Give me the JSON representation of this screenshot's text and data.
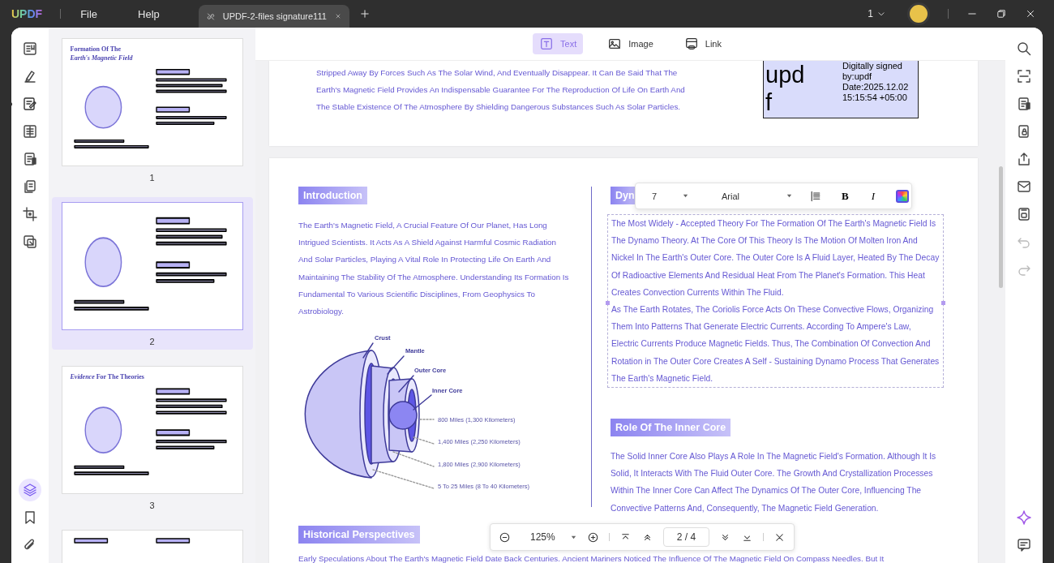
{
  "app": {
    "logo": "UPDF",
    "menu": [
      "File",
      "Help"
    ]
  },
  "tabs": [
    {
      "title": "UPDF-2-files signature111",
      "selected": true
    }
  ],
  "window": {
    "page_selector": "1"
  },
  "left_tools": [
    {
      "kind": "reader",
      "selected": false
    },
    {
      "kind": "comment",
      "selected": false
    },
    {
      "kind": "edit",
      "selected": true
    },
    {
      "kind": "form",
      "selected": false
    },
    {
      "kind": "convert",
      "selected": false
    },
    {
      "kind": "pages",
      "selected": false
    },
    {
      "kind": "crop",
      "selected": false
    },
    {
      "kind": "stack",
      "selected": false
    }
  ],
  "left_bottom_tools": [
    {
      "kind": "layers",
      "selected": true
    },
    {
      "kind": "bookmark",
      "selected": false
    },
    {
      "kind": "attachment",
      "selected": false
    }
  ],
  "thumbnails": [
    {
      "label": "1",
      "selected": false,
      "title": "Formation Of The",
      "subtitle": "Earth's Magnetic Field"
    },
    {
      "label": "2",
      "selected": true
    },
    {
      "label": "3",
      "selected": false,
      "title": "*Evidence* For The Theories"
    },
    {
      "selected": false
    }
  ],
  "edit_modes": [
    {
      "kind": "text",
      "label": "Text",
      "selected": true
    },
    {
      "kind": "image",
      "label": "Image",
      "selected": false
    },
    {
      "kind": "link",
      "label": "Link",
      "selected": false
    }
  ],
  "page1": {
    "paragraph": "Stripped Away By Forces Such As The Solar Wind, And Eventually Disappear. It Can Be Said That The Earth's Magnetic Field Provides An Indispensable Guarantee For The Reproduction Of Life On Earth And The Stable Existence Of The Atmosphere By Shielding Dangerous Substances Such As Solar Particles.",
    "signature": {
      "big_text": [
        "upd",
        "f"
      ],
      "lines": [
        "Digitally signed",
        "by:updf",
        "Date:2025.12.02",
        "15:15:54 +05:00"
      ]
    }
  },
  "page2": {
    "intro_heading": "Introduction",
    "intro_paragraph": "The Earth's Magnetic Field, A Crucial Feature Of Our Planet, Has Long Intrigued Scientists. It Acts As A Shield Against Harmful Cosmic Radiation And Solar Particles, Playing A Vital Role In Protecting Life On Earth And Maintaining The Stability Of The Atmosphere. Understanding Its Formation Is Fundamental To Various Scientific Disciplines, From Geophysics To Astrobiology.",
    "layers": [
      "Crust",
      "Mantle",
      "Outer Core",
      "Inner Core"
    ],
    "distances": [
      "800 Miles (1,300 Kilometers)",
      "1,400 Miles (2,250 Kilometers)",
      "1,800 Miles (2,900 Kilometers)",
      "5 To 25 Miles (8 To 40 Kilometers)"
    ],
    "right_heading": "Dyn",
    "selected_paragraphs": [
      "The Most Widely - Accepted Theory For The Formation Of The Earth's Magnetic Field Is The Dynamo Theory. At The Core Of This Theory Is The Motion Of Molten Iron And Nickel In The Earth's Outer Core. The Outer Core Is A Fluid Layer, Heated By The Decay Of Radioactive Elements And Residual Heat From The Planet's Formation. This Heat Creates Convection Currents Within The Fluid.",
      "As The Earth Rotates, The Coriolis Force Acts On These Convective Flows, Organizing Them Into Patterns That Generate Electric Currents. According To Ampere's Law, Electric Currents Produce Magnetic Fields. Thus, The Combination Of Convection And Rotation in The Outer Core Creates A Self - Sustaining Dynamo Process That Generates The Earth's Magnetic Field."
    ],
    "inner_core_heading": "Role Of The Inner Core",
    "inner_core_paragraph": "The Solid Inner Core Also Plays A Role In The Magnetic Field's Formation. Although It Is Solid, It Interacts With The Fluid Outer Core. The Growth And Crystallization Processes Within The Inner Core Can Affect The Dynamics Of The Outer Core, Influencing The Convective Patterns And, Consequently, The Magnetic Field Generation.",
    "history_heading": "Historical Perspectives",
    "history_paragraph": "Early Speculations About The Earth's Magnetic Field Date Back Centuries. Ancient Mariners Noticed The Influence Of The Magnetic Field On Compass Needles. But It"
  },
  "text_toolbar": {
    "font_size": "7",
    "font": "Arial",
    "bold": "B",
    "italic": "I"
  },
  "zoom_bar": {
    "zoom": "125%",
    "page": "2 / 4"
  },
  "right_tools": [
    {
      "kind": "search"
    },
    {
      "kind": "ocr"
    },
    {
      "kind": "convert"
    },
    {
      "kind": "protect"
    },
    {
      "kind": "share"
    },
    {
      "kind": "mail"
    },
    {
      "kind": "save"
    },
    {
      "kind": "undo"
    },
    {
      "kind": "redo"
    }
  ],
  "right_bottom_tools": [
    {
      "kind": "ai"
    },
    {
      "kind": "comment"
    }
  ]
}
